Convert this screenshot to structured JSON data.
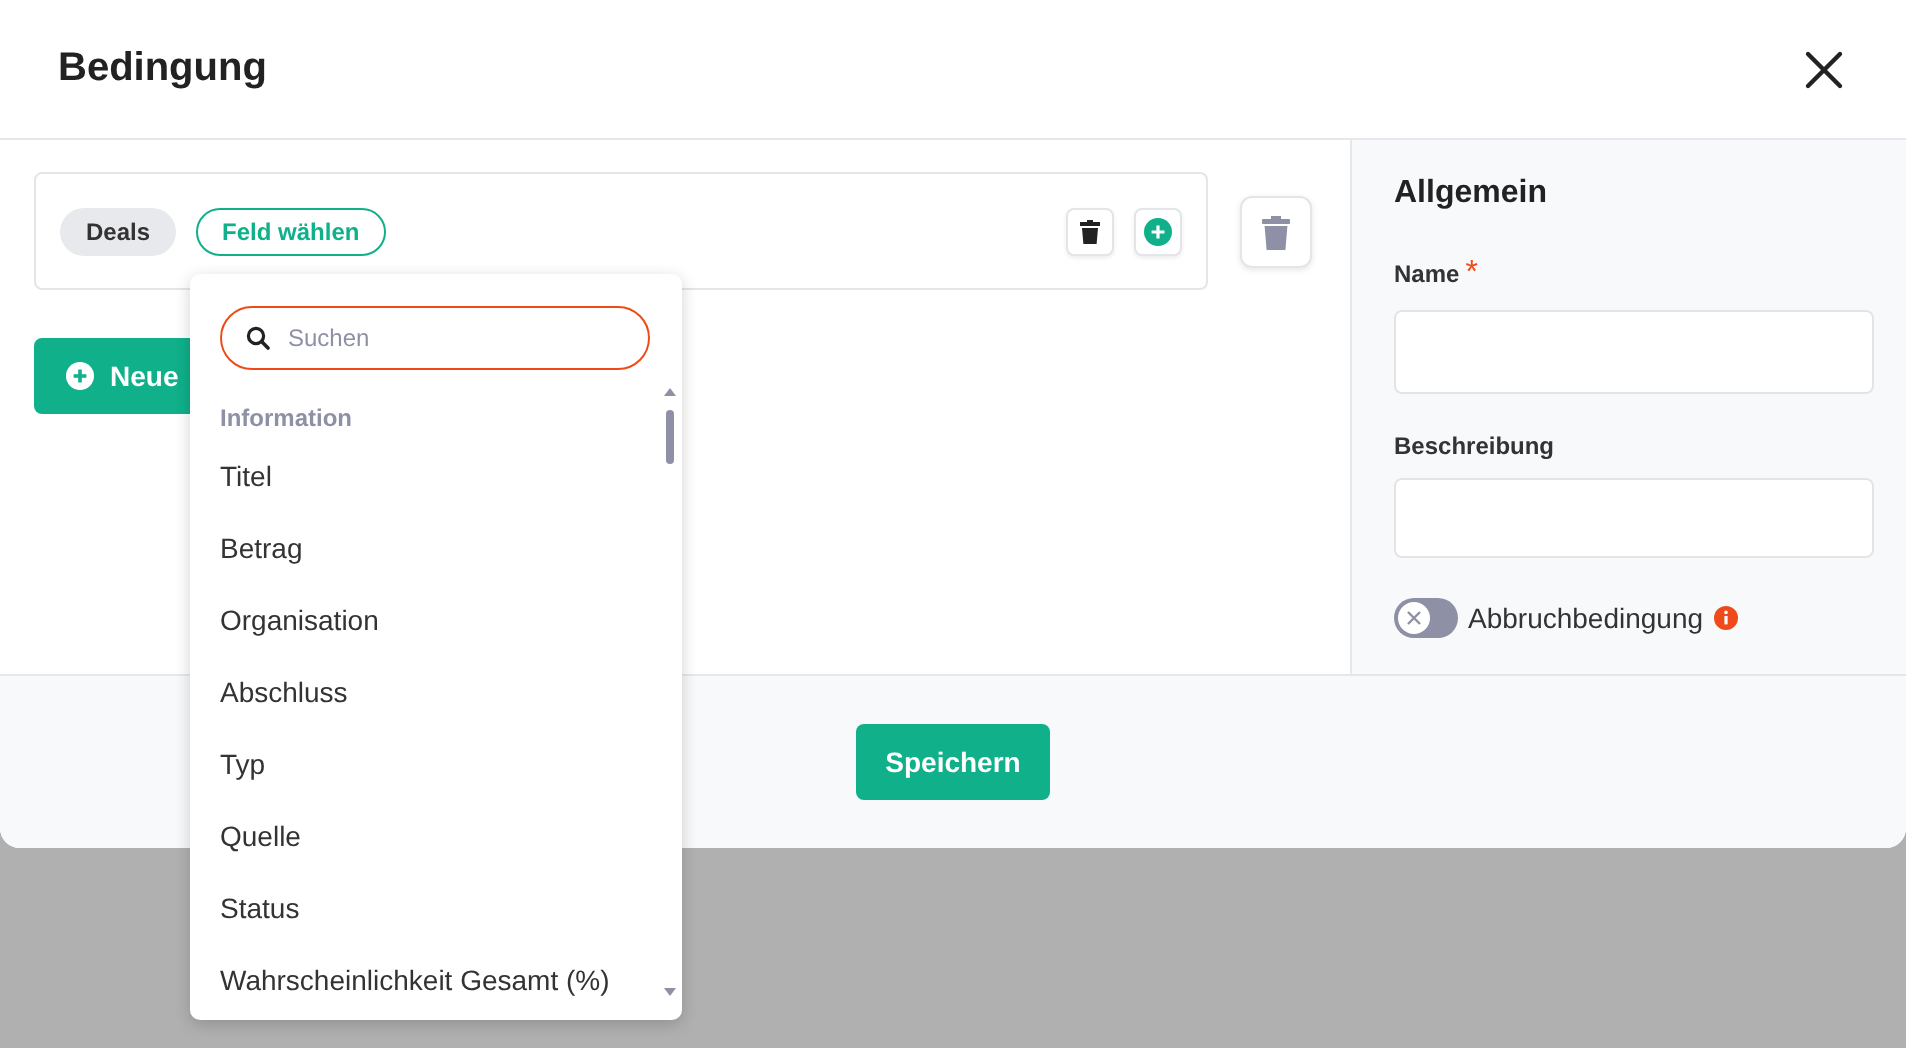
{
  "dialog": {
    "title": "Bedingung"
  },
  "condition": {
    "chips": [
      {
        "label": "Deals",
        "kind": "entity"
      },
      {
        "label": "Feld wählen",
        "kind": "select"
      }
    ]
  },
  "add_button": {
    "label": "Neue"
  },
  "dropdown": {
    "search": {
      "placeholder": "Suchen",
      "focused": true
    },
    "group": "Information",
    "options": [
      "Titel",
      "Betrag",
      "Organisation",
      "Abschluss",
      "Typ",
      "Quelle",
      "Status",
      "Wahrscheinlichkeit Gesamt (%)"
    ]
  },
  "panel": {
    "title": "Allgemein",
    "fields": [
      {
        "label": "Name",
        "required_mark": "*"
      },
      {
        "label": "Beschreibung"
      }
    ],
    "toggle": {
      "label": "Abbruchbedingung",
      "on": false
    }
  },
  "footer": {
    "save": "Speichern"
  }
}
